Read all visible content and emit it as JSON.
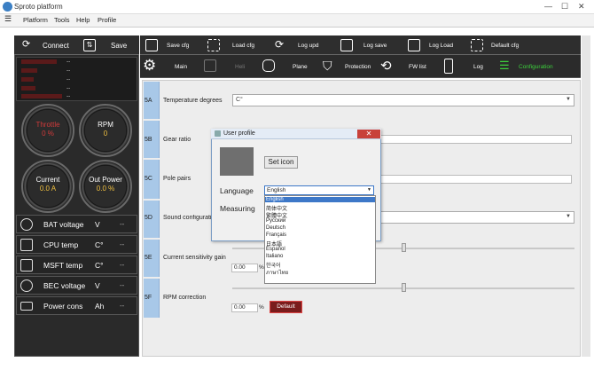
{
  "window": {
    "title": "Sproto platform"
  },
  "menu": [
    "Platform",
    "Tools",
    "Help",
    "Profile"
  ],
  "left": {
    "connect_label": "Connect",
    "save_label": "Save",
    "status_values": [
      "--",
      "--",
      "--",
      "--",
      "--"
    ],
    "gauges": [
      {
        "label": "Throttle",
        "value": "0 %",
        "color": "#d23a3a"
      },
      {
        "label": "RPM",
        "value": "0",
        "color": "#ffffff"
      },
      {
        "label": "Current",
        "value": "0.0 A",
        "color": "#ffffff"
      },
      {
        "label": "Out Power",
        "value": "0.0 %",
        "color": "#ffffff"
      }
    ],
    "rows": [
      {
        "name": "BAT voltage",
        "unit": "V",
        "value": "--"
      },
      {
        "name": "CPU temp",
        "unit": "C°",
        "value": "--"
      },
      {
        "name": "MSFT temp",
        "unit": "C°",
        "value": "--"
      },
      {
        "name": "BEC voltage",
        "unit": "V",
        "value": "--"
      },
      {
        "name": "Power cons",
        "unit": "Ah",
        "value": "--"
      }
    ]
  },
  "toolbar1": [
    "Save cfg",
    "Load cfg",
    "Log upd",
    "Log save",
    "Log Load",
    "Default cfg"
  ],
  "toolbar2": [
    {
      "label": "Main",
      "active": false
    },
    {
      "label": "Heli",
      "active": false,
      "disabled": true
    },
    {
      "label": "Plane",
      "active": false
    },
    {
      "label": "Protection",
      "active": false
    },
    {
      "label": "FW list",
      "active": false
    },
    {
      "label": "Log",
      "active": false
    },
    {
      "label": "Configuration",
      "active": true
    }
  ],
  "sections": [
    {
      "id": "5A",
      "label": "Temperature degrees",
      "value": "C°"
    },
    {
      "id": "5B",
      "label": "Gear ratio",
      "value": ""
    },
    {
      "id": "5C",
      "label": "Pole pairs",
      "value": ""
    },
    {
      "id": "5D",
      "label": "Sound configuration",
      "value": ""
    },
    {
      "id": "5E",
      "label": "Current sensitivity gain",
      "value": "0.00",
      "unit": "%"
    },
    {
      "id": "5F",
      "label": "RPM correction",
      "value": "0.00",
      "unit": "%",
      "button": "Default"
    }
  ],
  "dialog": {
    "title": "User profile",
    "set_icon": "Set icon",
    "language_label": "Language",
    "measuring_label": "Measuring",
    "language_value": "English",
    "options": [
      "English",
      "简体中文",
      "繁體中文",
      "Русский",
      "Deutsch",
      "Français",
      "日本語",
      "Español",
      "Italiano",
      "한국어",
      "ภาษาไทย"
    ]
  },
  "colors": {
    "accent": "#3d78c8",
    "active_tab": "#3cd03c",
    "danger": "#d23a3a"
  }
}
